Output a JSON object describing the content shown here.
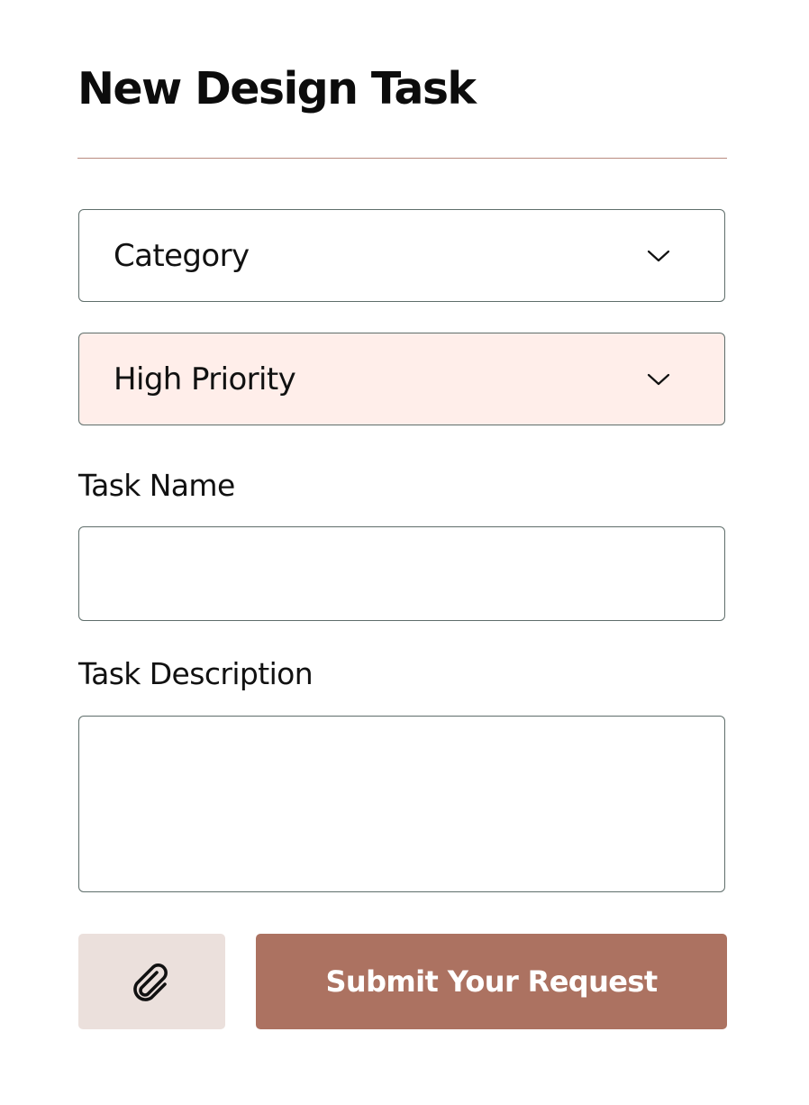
{
  "form": {
    "title": "New Design Task",
    "category_select": {
      "value": "Category",
      "icon": "chevron-down-icon"
    },
    "priority_select": {
      "value": "High Priority",
      "icon": "chevron-down-icon"
    },
    "task_name": {
      "label": "Task Name",
      "value": ""
    },
    "task_description": {
      "label": "Task Description",
      "value": ""
    },
    "attach_button": {
      "icon": "paperclip-icon"
    },
    "submit_button": {
      "label": "Submit Your Request"
    }
  },
  "colors": {
    "divider": "#b98b80",
    "field_border": "#5f6e6b",
    "priority_background": "#ffeeea",
    "attach_background": "#ebe0dc",
    "submit_background": "#ac7261",
    "submit_text": "#ffffff"
  }
}
